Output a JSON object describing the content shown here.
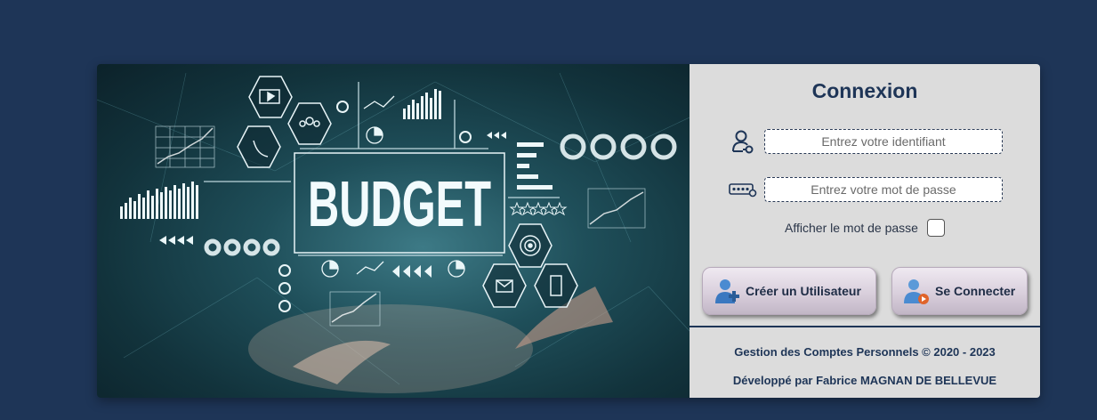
{
  "hero": {
    "budget_word": "BUDGET"
  },
  "login": {
    "title": "Connexion",
    "username_placeholder": "Entrez votre identifiant",
    "password_placeholder": "Entrez votre mot de passe",
    "show_password_label": "Afficher le mot de passe",
    "show_password_checked": false,
    "create_user_label": "Créer un Utilisateur",
    "connect_label": "Se Connecter"
  },
  "footer": {
    "line1": "Gestion des Comptes Personnels © 2020 - 2023",
    "line2": "Développé par Fabrice MAGNAN DE BELLEVUE"
  },
  "icons": {
    "user": "user-key-icon",
    "password": "password-dots-icon",
    "create_user": "add-user-icon",
    "connect": "user-login-icon"
  },
  "colors": {
    "background": "#1e3557",
    "panel": "#dcdcdc",
    "accent": "#1e3557"
  }
}
